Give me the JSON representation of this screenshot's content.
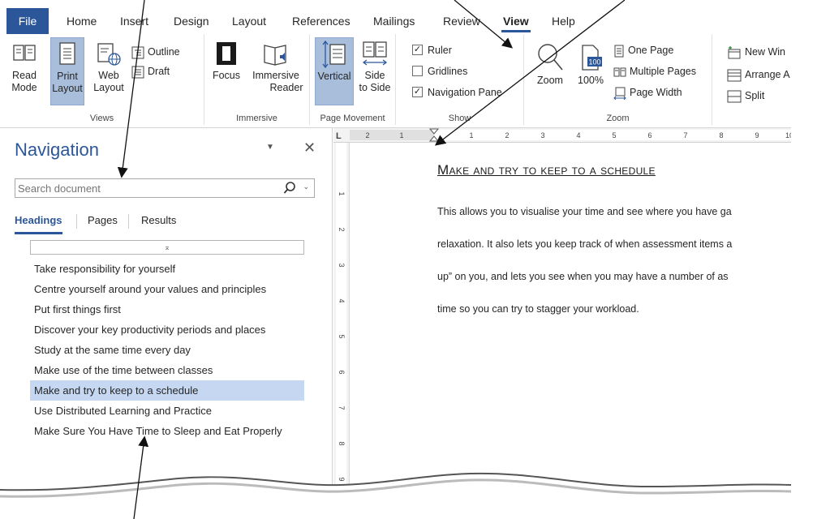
{
  "ribbon": {
    "tabs": [
      "File",
      "Home",
      "Insert",
      "Design",
      "Layout",
      "References",
      "Mailings",
      "Review",
      "View",
      "Help"
    ],
    "active_tab": "View",
    "views": {
      "label": "Views",
      "read_mode": [
        "Read",
        "Mode"
      ],
      "print_layout": [
        "Print",
        "Layout"
      ],
      "web_layout": [
        "Web",
        "Layout"
      ],
      "outline": "Outline",
      "draft": "Draft"
    },
    "immersive": {
      "label": "Immersive",
      "focus": "Focus",
      "immersive_reader": [
        "Immersive",
        "Reader"
      ]
    },
    "page_movement": {
      "label": "Page Movement",
      "vertical": "Vertical",
      "side_to_side": [
        "Side",
        "to Side"
      ]
    },
    "show": {
      "label": "Show",
      "ruler": "Ruler",
      "ruler_checked": true,
      "gridlines": "Gridlines",
      "gridlines_checked": false,
      "navigation_pane": "Navigation Pane",
      "navigation_pane_checked": true
    },
    "zoom": {
      "label": "Zoom",
      "zoom": "Zoom",
      "hundred": "100%",
      "hundred_icon_text": "100",
      "one_page": "One Page",
      "multiple_pages": "Multiple Pages",
      "page_width": "Page Width"
    },
    "window": {
      "new_window": "New Win",
      "arrange": "Arrange A",
      "split": "Split"
    }
  },
  "navigation": {
    "title": "Navigation",
    "search_placeholder": "Search document",
    "tabs": [
      "Headings",
      "Pages",
      "Results"
    ],
    "active_tab": "Headings",
    "collapse_glyph": "⌅",
    "headings": [
      "Take responsibility for yourself",
      "Centre yourself around your values and principles",
      "Put first things first",
      "Discover your key productivity periods and places",
      "Study at the same time every day",
      "Make use of the time between classes",
      "Make and try to keep to a schedule",
      "Use Distributed Learning and Practice",
      "Make Sure You Have Time to Sleep and Eat Properly"
    ],
    "selected_heading": "Make and try to keep to a schedule"
  },
  "ruler": {
    "corner": "L",
    "h_numbers": [
      "2",
      "1",
      "1",
      "2",
      "3",
      "4",
      "5",
      "6",
      "7",
      "8",
      "9",
      "10"
    ],
    "v_numbers": [
      "1",
      "2",
      "3",
      "4",
      "5",
      "6",
      "7",
      "8",
      "9"
    ]
  },
  "document": {
    "heading": "Make and try to keep to a schedule",
    "lines": [
      "This allows you to visualise your time and see where you have ga",
      "relaxation. It also lets you keep track of when assessment items a",
      "up” on you, and lets you see when you may have a number of as",
      "time so you can try to stagger your workload."
    ]
  },
  "colors": {
    "accent": "#2b579a",
    "selected_button": "#a8bedb",
    "selected_heading": "#c5d7f1"
  }
}
